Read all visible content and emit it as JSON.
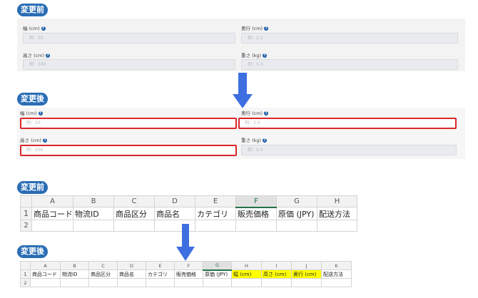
{
  "before_badge": "変更前",
  "after_badge": "変更後",
  "form_before": {
    "fields": [
      {
        "label": "幅 (cm)",
        "help": "?",
        "placeholder": "例：20"
      },
      {
        "label": "奥行 (cm)",
        "help": "?",
        "placeholder": "例：2.5"
      },
      {
        "label": "高さ (cm)",
        "help": "?",
        "placeholder": "例：500"
      },
      {
        "label": "重さ (kg)",
        "help": "?",
        "placeholder": "例：5.0"
      }
    ]
  },
  "form_after": {
    "fields": [
      {
        "label": "幅 (cm)",
        "help": "?",
        "placeholder": "例：20",
        "highlighted": true
      },
      {
        "label": "奥行 (cm)",
        "help": "?",
        "placeholder": "例：2.5",
        "highlighted": true
      },
      {
        "label": "高さ (cm)",
        "help": "?",
        "placeholder": "例：500",
        "highlighted": true
      },
      {
        "label": "重さ (kg)",
        "help": "?",
        "placeholder": "例：5.0",
        "highlighted": false
      }
    ]
  },
  "sheet_before": {
    "columns": [
      "A",
      "B",
      "C",
      "D",
      "E",
      "F",
      "G",
      "H"
    ],
    "selected_column": "F",
    "rows": [
      {
        "num": "1",
        "cells": [
          "商品コード",
          "物流ID",
          "商品区分",
          "商品名",
          "カテゴリ",
          "販売価格",
          "原価 (JPY)",
          "配送方法"
        ]
      },
      {
        "num": "2",
        "cells": [
          "",
          "",
          "",
          "",
          "",
          "",
          "",
          ""
        ]
      }
    ]
  },
  "sheet_after": {
    "columns": [
      "A",
      "B",
      "C",
      "D",
      "E",
      "F",
      "G",
      "H",
      "I",
      "J",
      "K"
    ],
    "selected_column": "G",
    "rows": [
      {
        "num": "1",
        "cells": [
          "商品コード",
          "物流ID",
          "商品区分",
          "商品名",
          "カテゴリ",
          "販売価格",
          "原価 (JPY)",
          "幅 (cm)",
          "高さ (cm)",
          "奥行 (cm)",
          "配送方法"
        ]
      },
      {
        "num": "2",
        "cells": [
          "",
          "",
          "",
          "",
          "",
          "",
          "",
          "",
          "",
          "",
          ""
        ]
      }
    ],
    "highlighted_columns": [
      "H",
      "I",
      "J"
    ]
  },
  "colors": {
    "badge": "#2a6db5",
    "arrow": "#3d6fe0",
    "highlight_border": "#d9262a",
    "highlight_fill": "#ffff00"
  }
}
